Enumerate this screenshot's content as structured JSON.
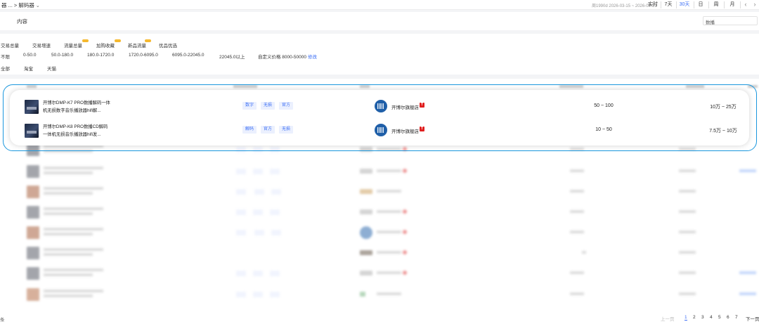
{
  "topbar": {
    "breadcrumb": "器 ... > 解码器",
    "date_range": "周1990d 2026-03-15 ~ 2026-04-13",
    "ranges": [
      "实时",
      "7天",
      "30天",
      "日",
      "周",
      "月"
    ],
    "active_range": "30天",
    "prev_arrow": "‹",
    "next_arrow": "›"
  },
  "content": {
    "title": "内容",
    "search_value": "数播"
  },
  "filters": {
    "metrics": [
      "交易总量",
      "交易增速",
      "流量总量",
      "加购收藏",
      "新品流量",
      "优品优选"
    ],
    "price_label": "不限",
    "price_ranges": [
      "0-50.0",
      "50.0-180.0",
      "180.0-1720.0",
      "1720.0-6095.0",
      "6095.0-22045.0",
      "22045.0以上"
    ],
    "custom_price": "自定义价格 8000-50000",
    "edit_label": "修改",
    "platforms": [
      "全部",
      "淘宝",
      "天猫"
    ]
  },
  "products": [
    {
      "title": "开博尔DMP-K7 PRO数播解码一体机无损数字音乐播放器hifi解...",
      "tags": [
        "数字",
        "无损",
        "官方"
      ],
      "shop": "开博尔旗舰店",
      "range1": "50 ~ 100",
      "range2": "10万 ~ 25万"
    },
    {
      "title": "开博尔DMP-K8 PRO数播CD解码一体机无损音乐播放器hifi发...",
      "tags": [
        "解码",
        "官方",
        "无损"
      ],
      "shop": "开博尔旗舰店",
      "range1": "10 ~ 50",
      "range2": "7.5万 ~ 10万"
    }
  ],
  "pagination": {
    "left_fragment": "条",
    "prev": "上一页",
    "pages": [
      "1",
      "2",
      "3",
      "4",
      "5",
      "6",
      "7"
    ],
    "current": "1",
    "next": "下一页"
  },
  "colors": {
    "accent": "#3b6ef5",
    "highlight_border": "#1b97dd",
    "tmall_red": "#e02020",
    "badge_yellow": "#f5b82e"
  },
  "icons": {
    "breadcrumb_dropdown": "chevron-down-icon",
    "shop_logo": "kaiboer-logo-icon",
    "tmall": "tmall-icon"
  }
}
